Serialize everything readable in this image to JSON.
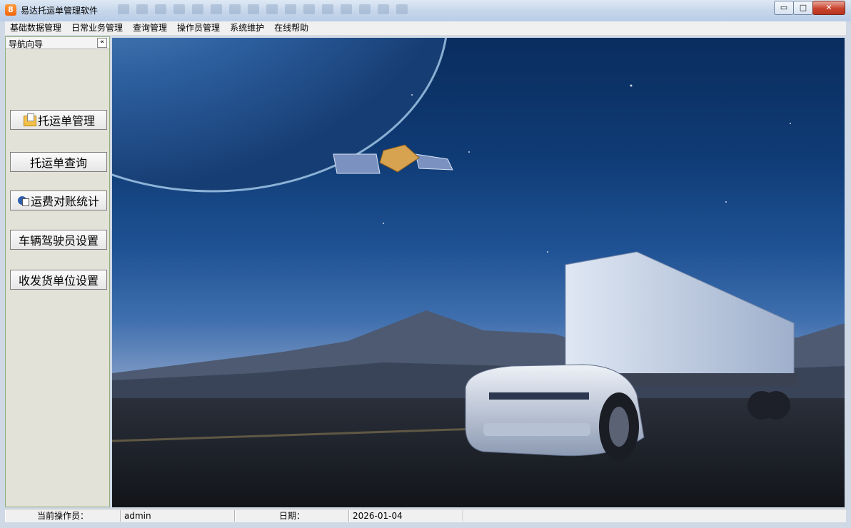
{
  "window": {
    "title": "易达托运单管理软件",
    "app_icon_glyph": "8",
    "controls": {
      "minimize": "▭",
      "maximize": "□",
      "close": "✕"
    }
  },
  "menu": [
    {
      "label": "基础数据管理"
    },
    {
      "label": "日常业务管理"
    },
    {
      "label": "查询管理"
    },
    {
      "label": "操作员管理"
    },
    {
      "label": "系统维护"
    },
    {
      "label": "在线帮助"
    }
  ],
  "nav": {
    "title": "导航向导",
    "collapse_glyph": "«",
    "buttons": [
      {
        "label": "托运单管理",
        "icon": "folder-icon"
      },
      {
        "label": "托运单查询",
        "icon": ""
      },
      {
        "label": "运费对账统计",
        "icon": "chart-icon"
      },
      {
        "label": "车辆驾驶员设置",
        "icon": ""
      },
      {
        "label": "收发货单位设置",
        "icon": ""
      }
    ]
  },
  "main": {
    "background": "space-satellite-truck-banner"
  },
  "status": {
    "operator_label": "当前操作员：",
    "operator_value": "admin",
    "date_label": "日期：",
    "date_value": "2026-01-04"
  },
  "colors": {
    "nav_border": "#8fae7c",
    "close_button": "#c9442f",
    "sky_top": "#0a2d5e"
  }
}
